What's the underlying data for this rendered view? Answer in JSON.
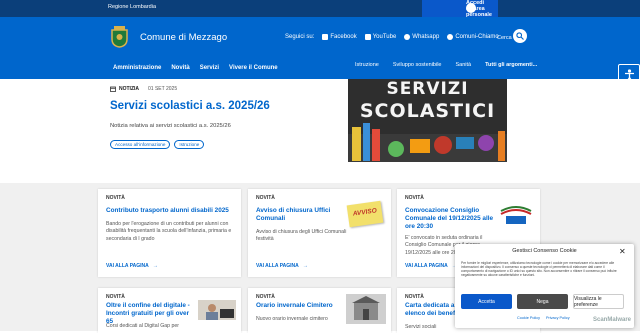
{
  "topbar": {
    "region": "Regione Lombardia",
    "login": "Accedi all'area personale"
  },
  "header": {
    "municipality": "Comune di Mezzago",
    "follow_label": "Seguici su:",
    "social": [
      "Facebook",
      "YouTube",
      "Whatsapp",
      "Comuni-Chiamo"
    ],
    "search_label": "Cerca",
    "nav_main": [
      "Amministrazione",
      "Novità",
      "Servizi",
      "Vivere il Comune"
    ],
    "nav_topics": [
      "Istruzione",
      "Sviluppo sostenibile",
      "Sanità",
      "Tutti gli argomenti..."
    ]
  },
  "hero": {
    "tag": "NOTIZIA",
    "date": "01 SET 2025",
    "title": "Servizi scolastici a.s. 2025/26",
    "description": "Notizia relativa ai servizi scolastici a.s. 2025/26",
    "chips": [
      "Accesso all'informazione",
      "Istruzione"
    ],
    "image_text": [
      "SERVIZI",
      "SCOLASTICI"
    ]
  },
  "cards": [
    {
      "label": "NOVITÀ",
      "title": "Contributo trasporto alunni disabili 2025",
      "desc": "Bando per l'erogazione di un contributi per alunni con disabilità frequentanti la scuola dell'infanzia, primaria e secondaria di I grado",
      "more": "VAI ALLA PAGINA"
    },
    {
      "label": "NOVITÀ",
      "title": "Avviso di chiusura Uffici Comunali",
      "desc": "Avviso di chiusura degli Uffici Comunali festività",
      "more": "VAI ALLA PAGINA",
      "note": "AVVISO"
    },
    {
      "label": "NOVITÀ",
      "title": "Convocazione Consiglio Comunale del 19/12/2025 alle ore 20:30",
      "desc": "E' convocato in seduta ordinaria il Consiglio Comunale per il giorno 19/12/2025 alle ore 20:30",
      "more": "VAI ALLA PAGINA"
    },
    {
      "label": "NOVITÀ",
      "title": "Oltre il confine del digitale - Incontri gratuiti per gli over 65",
      "desc": "Corsi dedicati al Digital Gap per",
      "more": ""
    },
    {
      "label": "NOVITÀ",
      "title": "Orario invernale Cimitero",
      "desc": "Nuovo orario invernale cimitero",
      "more": ""
    },
    {
      "label": "NOVITÀ",
      "title": "Carta dedicata a te 2025: elenco dei beneficiari",
      "desc": "Servizi sociali",
      "more": ""
    }
  ],
  "cookie": {
    "heading": "Gestisci Consenso Cookie",
    "text": "Per fornire le migliori esperienze, utilizziamo tecnologie come i cookie per memorizzare e/o accedere alle informazioni del dispositivo. Il consenso a queste tecnologie ci permetterà di elaborare dati come il comportamento di navigazione o ID unici su questo sito. Non acconsentire o ritirare il consenso può influire negativamente su alcune caratteristiche e funzioni.",
    "accept": "Accetta",
    "deny": "Nega",
    "prefs": "Visualizza le preferenze",
    "links": [
      "Cookie Policy",
      "Privacy Policy"
    ]
  },
  "watermark": "ScanMalware",
  "colors": {
    "brand": "#0066cc",
    "topbar": "#0b3f7a",
    "accent": "#0a58ca"
  }
}
